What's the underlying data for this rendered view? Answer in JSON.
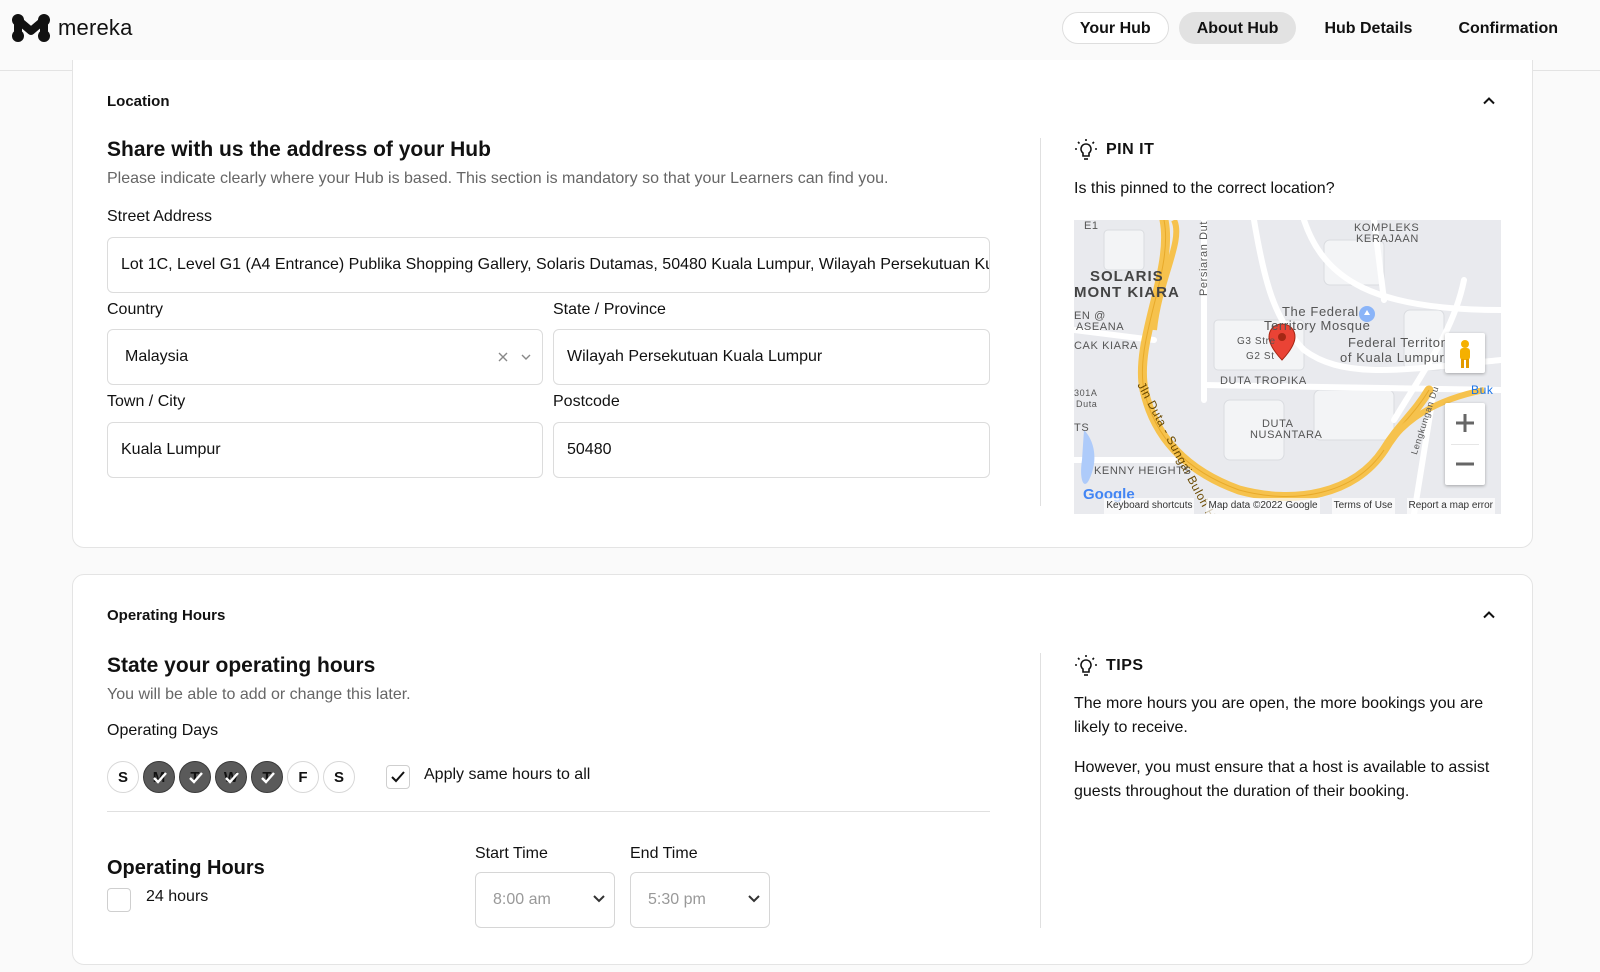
{
  "brand": {
    "name": "mereka"
  },
  "steps": [
    {
      "label": "Your Hub"
    },
    {
      "label": "About Hub"
    },
    {
      "label": "Hub Details"
    },
    {
      "label": "Confirmation"
    }
  ],
  "location": {
    "section_label": "Location",
    "title": "Share with us the address of your Hub",
    "subtitle": "Please indicate clearly where your Hub is based. This section is mandatory so that your Learners can find you.",
    "street_label": "Street Address",
    "street_value": "Lot 1C, Level G1 (A4 Entrance) Publika Shopping Gallery, Solaris Dutamas, 50480 Kuala Lumpur, Wilayah Persekutuan Kuala Lumpur, Malaysia",
    "country_label": "Country",
    "country_value": "Malaysia",
    "state_label": "State / Province",
    "state_value": "Wilayah Persekutuan Kuala Lumpur",
    "city_label": "Town / City",
    "city_value": "Kuala Lumpur",
    "postcode_label": "Postcode",
    "postcode_value": "50480"
  },
  "pin": {
    "heading": "PIN IT",
    "question": "Is this pinned to the correct location?",
    "map": {
      "labels": {
        "e1": "E1",
        "solaris": "SOLARIS",
        "mont_kiara": "MONT KIARA",
        "persiaran": "Persiaran Dut",
        "kompleks": "KOMPLEKS",
        "kerajaan": "KERAJAAN",
        "federal_mosque_1": "The Federal",
        "federal_mosque_2": "Territory Mosque",
        "federal_territory_1": "Federal Territor",
        "federal_territory_2": "of Kuala Lumpur",
        "g3": "G3 Stre",
        "g2": "G2 St",
        "duta_tropika": "DUTA TROPIKA",
        "en_asean_1": "EN @",
        "en_asean_2": "ASEANA",
        "cak_kiara": "CAK KIARA",
        "r301a_1": "301A",
        "r301a_2": "Duta",
        "jln_duta": "Jln Duta - Sungai Buloh Hwy",
        "duta_nusantara_1": "DUTA",
        "duta_nusantara_2": "NUSANTARA",
        "ts": "TS",
        "kenny_heights": "KENNY HEIGHTS",
        "lengkungan": "Lengkungan Du",
        "buk": "Buk"
      },
      "footer": {
        "logo": "Google",
        "shortcuts": "Keyboard shortcuts",
        "map_data": "Map data ©2022 Google",
        "terms": "Terms of Use",
        "report": "Report a map error"
      }
    }
  },
  "hours": {
    "section_label": "Operating Hours",
    "title": "State your operating hours",
    "subtitle": "You will be able to add or change this later.",
    "days_label": "Operating Days",
    "days": [
      {
        "letter": "S",
        "selected": false
      },
      {
        "letter": "M",
        "selected": true
      },
      {
        "letter": "T",
        "selected": true
      },
      {
        "letter": "W",
        "selected": true
      },
      {
        "letter": "T",
        "selected": true
      },
      {
        "letter": "F",
        "selected": false
      },
      {
        "letter": "S",
        "selected": false
      }
    ],
    "apply_same_label": "Apply same hours to all",
    "apply_same_checked": true,
    "hours_heading": "Operating Hours",
    "all_day_label": "24 hours",
    "all_day_checked": false,
    "start_label": "Start Time",
    "start_value": "8:00 am",
    "end_label": "End Time",
    "end_value": "5:30 pm"
  },
  "tips": {
    "heading": "TIPS",
    "p1": "The more hours you are open, the more bookings you are likely to receive.",
    "p2": "However, you must ensure that a host is available to assist guests throughout the duration of their booking."
  },
  "colors": {
    "accent": "#111111",
    "selected_day": "#5a5a5a",
    "active_step": "#e2e2e2",
    "map_road": "#f6c24d",
    "map_pin": "#ea4335"
  }
}
